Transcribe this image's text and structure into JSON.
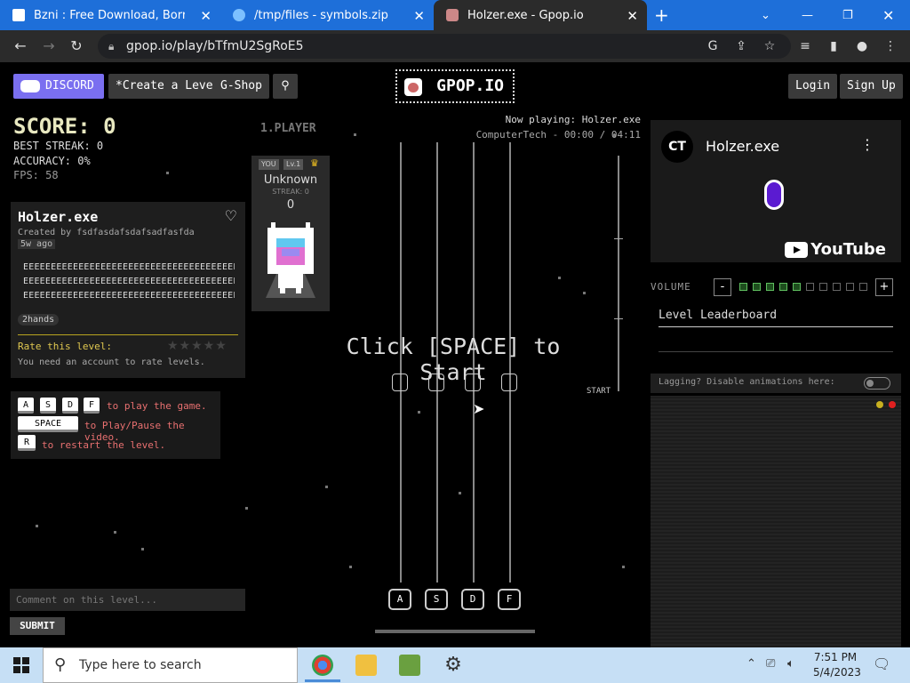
{
  "browser": {
    "tabs": [
      {
        "title": "Bzni : Free Download, Borrow, an",
        "icon": "archive-icon"
      },
      {
        "title": "/tmp/files - symbols.zip",
        "icon": "onedrive-icon"
      },
      {
        "title": "Holzer.exe - Gpop.io",
        "icon": "gpop-favicon"
      }
    ],
    "url": "gpop.io/play/bTfmU2SgRoE5"
  },
  "nav": {
    "discord": "DISCORD",
    "create": "*Create a Level",
    "shop": "G-Shop",
    "logo": "GPOP.IO",
    "login": "Login",
    "signup": "Sign Up"
  },
  "stats": {
    "score": "SCORE: 0",
    "best_streak": "BEST STREAK: 0",
    "accuracy": "ACCURACY: 0%",
    "fps": "FPS: 58"
  },
  "player": {
    "label": "1.PLAYER",
    "badge_you": "YOU",
    "badge_level": "Lv.1",
    "name": "Unknown",
    "streak": "STREAK: 0",
    "score": "0"
  },
  "song": {
    "title": "Holzer.exe",
    "creator": "Created by fsdfasdafsdafsadfasfda",
    "age": "5w ago",
    "description": [
      "EEEEEEEEEEEEEEEEEEEEEEEEEEEEEEEEEEEEEEEEEE",
      "EEEEEEEEEEEEEEEEEEEEEEEEEEEEEEEEEEEEEEEEEE",
      "EEEEEEEEEEEEEEEEEEEEEEEEEEEEEEEEEEEEEEEEP..."
    ],
    "tag": "2hands",
    "rate_label": "Rate this level:",
    "rate_note": "You need an account to rate levels."
  },
  "help": {
    "keys": [
      "A",
      "S",
      "D",
      "F"
    ],
    "play_text": "to play the game.",
    "space_key": "SPACE",
    "space_text": "to Play/Pause the video.",
    "r_key": "R",
    "r_text": "to restart the level."
  },
  "comment": {
    "placeholder": "Comment on this level...",
    "submit": "SUBMIT"
  },
  "game": {
    "now_playing": "Now playing: Holzer.exe",
    "time": "ComputerTech - 00:00 / 04:11",
    "click_start": "Click [SPACE] to Start",
    "start_marker": "START",
    "lane_keys": [
      "A",
      "S",
      "D",
      "F"
    ]
  },
  "video": {
    "channel_initials": "CT",
    "title": "Holzer.exe",
    "youtube": "YouTube"
  },
  "volume": {
    "label": "VOLUME",
    "minus": "-",
    "plus": "+",
    "level": 5,
    "segments": 10
  },
  "leaderboard": {
    "title": "Level Leaderboard"
  },
  "lag": {
    "label": "Lagging? Disable animations here:"
  },
  "taskbar": {
    "search": "Type here to search",
    "time": "7:51 PM",
    "date": "5/4/2023"
  },
  "colors": {
    "discord": "#7a6ff0",
    "score": "#e8e8c0",
    "help_text": "#e87070",
    "rate_label": "#e0c850",
    "volume_on": "#5fbf5f"
  }
}
